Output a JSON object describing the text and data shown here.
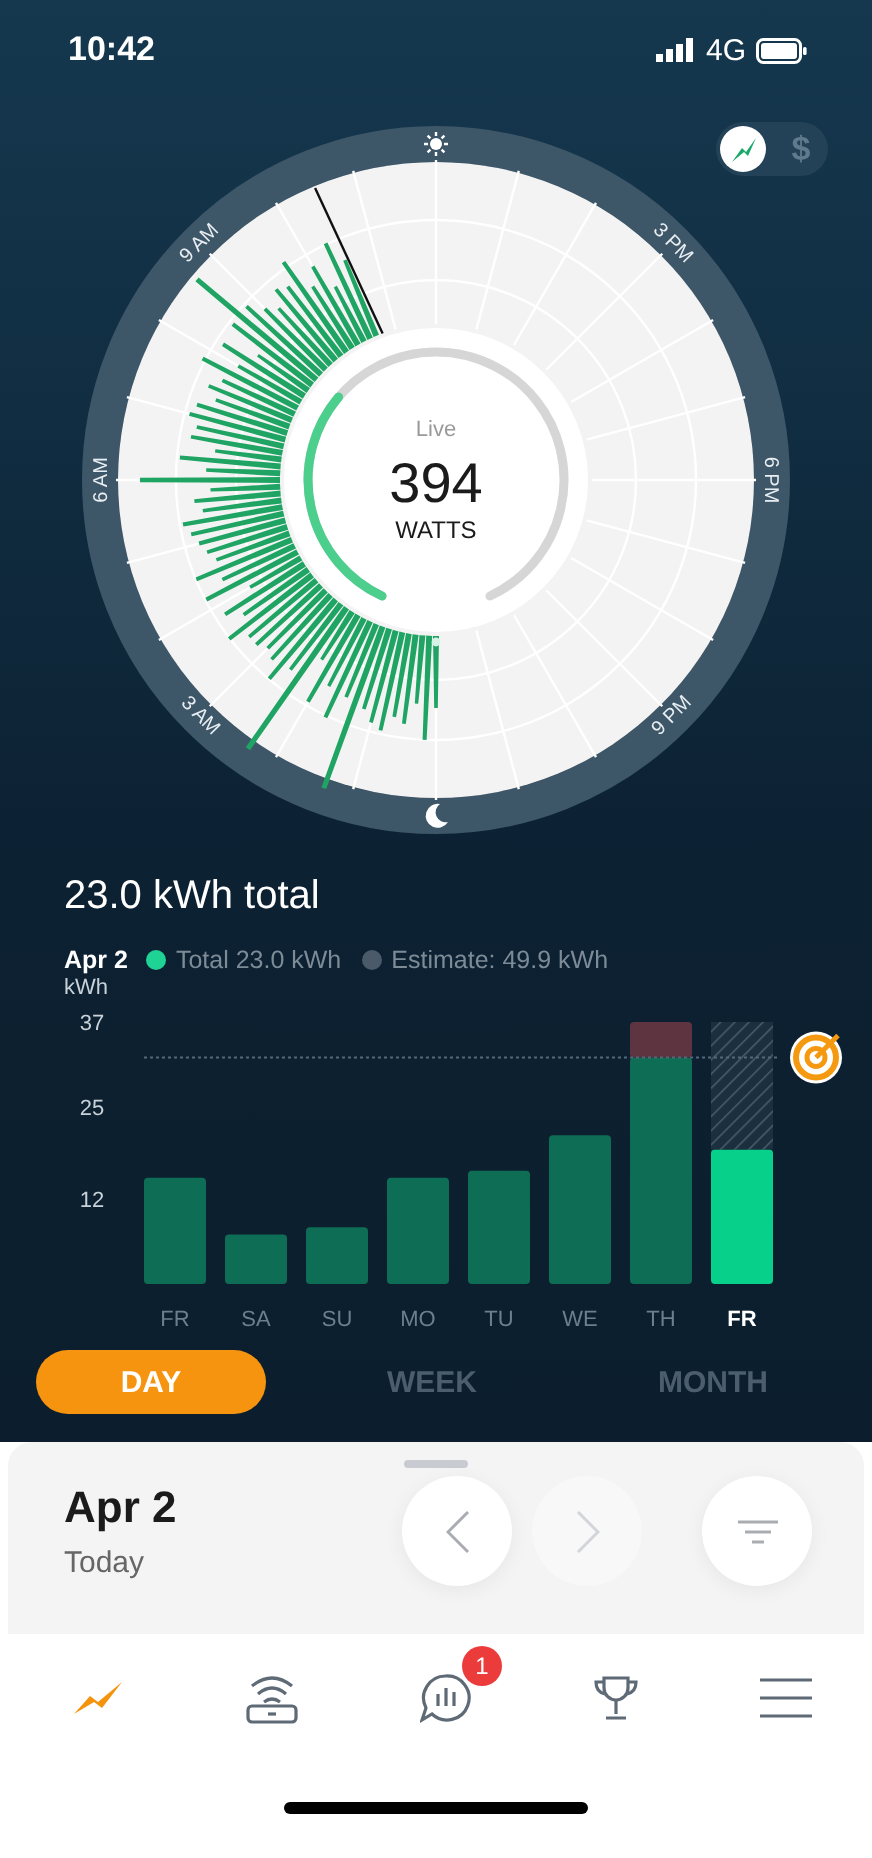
{
  "status_bar": {
    "time": "10:42",
    "network": "4G"
  },
  "mode_toggle": [
    {
      "kind": "energy",
      "selected": true
    },
    {
      "kind": "cost",
      "label": "$",
      "selected": false
    }
  ],
  "live_dial": {
    "hour_labels": [
      "9 AM",
      "3 PM",
      "6 PM",
      "9 PM",
      "3 AM",
      "6 AM"
    ],
    "caption": "Live",
    "value": "394",
    "unit": "WATTS"
  },
  "summary": {
    "title": "23.0 kWh total",
    "date": "Apr 2",
    "legend": [
      {
        "label": "Total 23.0 kWh",
        "color": "#1ed394"
      },
      {
        "label": "Estimate: 49.9 kWh",
        "color": "#4a5a68"
      }
    ]
  },
  "chart_data": {
    "type": "bar",
    "ylabel": "kWh",
    "categories": [
      "FR",
      "SA",
      "SU",
      "MO",
      "TU",
      "WE",
      "TH",
      "FR"
    ],
    "ylim": [
      0,
      37
    ],
    "yticks": [
      12,
      25,
      37
    ],
    "stacked": true,
    "series": [
      {
        "color": "#0e6e55",
        "values": [
          15,
          7,
          8,
          15,
          16,
          21,
          32,
          null
        ]
      },
      {
        "color": "#5e3440",
        "values": [
          null,
          null,
          null,
          null,
          null,
          null,
          5,
          null
        ]
      },
      {
        "color": "#07d08a",
        "values": [
          null,
          null,
          null,
          null,
          null,
          null,
          null,
          19
        ]
      },
      {
        "color": "#4c5d6b",
        "values": [
          null,
          null,
          null,
          null,
          null,
          null,
          null,
          18
        ]
      }
    ],
    "ref_lines": [
      {
        "axis": "y",
        "value": 32
      }
    ]
  },
  "range_tabs": [
    {
      "label": "DAY",
      "selected": true
    },
    {
      "label": "WEEK",
      "selected": false
    },
    {
      "label": "MONTH",
      "selected": false
    }
  ],
  "day_panel": {
    "date": "Apr 2",
    "subtitle": "Today",
    "buttons": [
      {
        "kind": "previous",
        "disabled": false
      },
      {
        "kind": "next",
        "disabled": true
      },
      {
        "kind": "filter",
        "disabled": false
      }
    ]
  },
  "nav": [
    {
      "kind": "live",
      "selected": true
    },
    {
      "kind": "device",
      "selected": false
    },
    {
      "kind": "insights",
      "selected": false,
      "badge": "1"
    },
    {
      "kind": "trophy",
      "selected": false
    },
    {
      "kind": "menu",
      "selected": false
    }
  ]
}
